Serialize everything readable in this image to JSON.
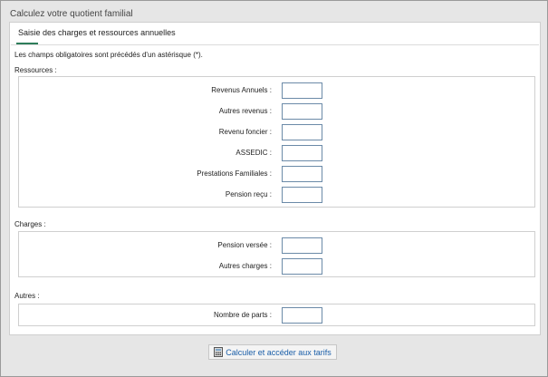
{
  "window": {
    "title": "Calculez votre quotient familial"
  },
  "tab": {
    "label": "Saisie des charges et ressources annuelles"
  },
  "intro_text": "Les champs obligatoires sont précédés d'un astérisque (*).",
  "sections": {
    "ressources": {
      "label": "Ressources :",
      "fields": [
        {
          "label": "Revenus Annuels :",
          "value": ""
        },
        {
          "label": "Autres revenus :",
          "value": ""
        },
        {
          "label": "Revenu foncier :",
          "value": ""
        },
        {
          "label": "ASSEDIC :",
          "value": ""
        },
        {
          "label": "Prestations Familiales :",
          "value": ""
        },
        {
          "label": "Pension reçu :",
          "value": ""
        }
      ]
    },
    "charges": {
      "label": "Charges :",
      "fields": [
        {
          "label": "Pension versée :",
          "value": ""
        },
        {
          "label": "Autres charges :",
          "value": ""
        }
      ]
    },
    "autres": {
      "label": "Autres :",
      "fields": [
        {
          "label": "Nombre de parts :",
          "value": ""
        }
      ]
    }
  },
  "submit": {
    "label": "Calculer et accéder aux tarifs",
    "icon": "calculator-icon"
  },
  "colors": {
    "accent": "#2e7d5b",
    "link": "#1a5ea8",
    "input_border": "#6b8aa8"
  }
}
